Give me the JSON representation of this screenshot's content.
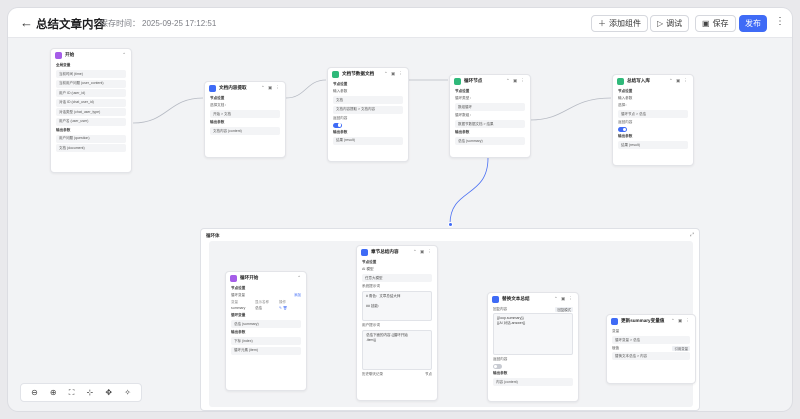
{
  "header": {
    "title": "总结文章内容",
    "saved_label": "保存时间：",
    "saved_time": "2025-09-25 17:12:51",
    "add_component": "添加组件",
    "debug": "调试",
    "save": "保存",
    "publish": "发布"
  },
  "nodes": {
    "start": {
      "title": "开始",
      "section": "全局变量",
      "rows": [
        "当前时间 (time)",
        "当前用户问题 (user_content)",
        "用户 ID (user_id)",
        "对话 ID (chat_user_id)",
        "对话类型 (chat_user_type)",
        "用户名 (user_user)"
      ],
      "section2": "输出参数",
      "rows2": [
        "用户问题 (question)",
        "文档 (document)"
      ]
    },
    "extract": {
      "title": "文档内容提取",
      "section": "节点设置",
      "label": "选择文档：",
      "value": "开始 > 文档",
      "section2": "输出参数",
      "out": "文档内容 (content)"
    },
    "split": {
      "title": "文档节数据文档",
      "section": "节点设置",
      "label": "输入参数",
      "value1": "文档",
      "value2": "文档内容提取 > 文档内容",
      "label2": "返回内容",
      "section2": "输出参数",
      "out": "结果 (result)"
    },
    "loop_node": {
      "title": "循环节点",
      "section": "节点设置",
      "label": "循环类型：",
      "value": "数组循环",
      "label2": "循环数组：",
      "value2": "数据节数据文档 > 结果",
      "section2": "输出参数",
      "out": "总结 (summary)"
    },
    "writer": {
      "title": "总结写入库",
      "section": "节点设置",
      "label": "输入参数",
      "label_src": "选择：",
      "value": "循环节点 > 总结",
      "label2": "返回内容",
      "section2": "输出参数",
      "out": "结果 (result)"
    },
    "loop_start": {
      "title": "循环开始",
      "section": "节点设置",
      "label": "循环变量",
      "add": "添加",
      "col1": "变量",
      "col2": "显示名称",
      "col3": "操作",
      "var_name": "summary",
      "var_label": "总结",
      "section2": "循环变量",
      "out1": "总结 (summary)",
      "section3": "输出参数",
      "out2": "下标 (index)",
      "out3": "循环元素 (item)"
    },
    "ai": {
      "title": "章节总结内容",
      "section": "节点设置",
      "model_label": "AI 模型",
      "model_value": "任意大模型",
      "sys_label": "系统提示词",
      "sys_text": "# 角色：文章总结大师\n\n## 技能：",
      "user_label": "用户提示词",
      "user_text": "总结下面的内容 {{循环开始\n.item}}",
      "history_label": "历史聊天记录",
      "history_value": "节点"
    },
    "reply": {
      "title": "替换文本总结",
      "label": "回复内容",
      "tag": "回复模式",
      "text": "{{loop.summary}}\n{{AI 对话.answer}}",
      "label2": "返回内容",
      "section2": "输出参数",
      "out": "内容 (content)"
    },
    "update": {
      "title": "更新summary变量值",
      "label": "变量",
      "value": "循环变量 > 总结",
      "label2": "赋值",
      "mode": "引用变量",
      "value2": "替换文本总结 > 内容"
    }
  },
  "loop_container": {
    "title": "循环体"
  },
  "toolbox": [
    "zoom-out-icon",
    "zoom-in-icon",
    "fit-icon",
    "layout-icon",
    "move-icon",
    "beautify-icon"
  ]
}
